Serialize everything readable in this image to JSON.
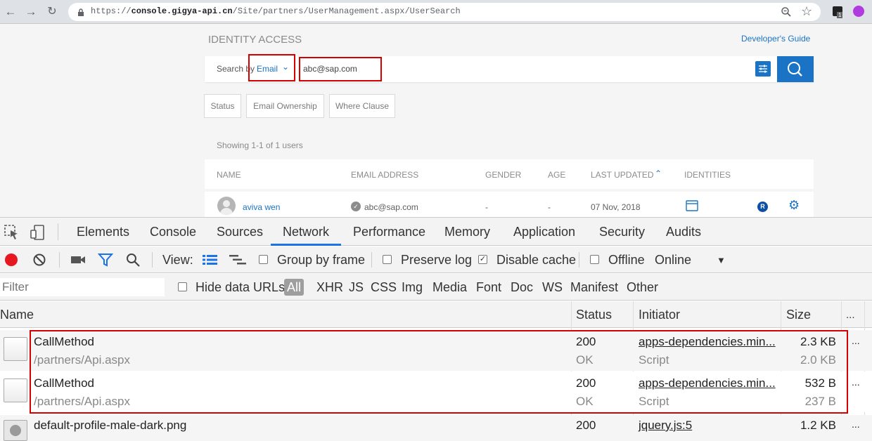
{
  "browser": {
    "url_scheme": "https://",
    "url_host": "console.gigya-api.cn",
    "url_path": "/Site/partners/UserManagement.aspx/UserSearch",
    "ext_badge": "1"
  },
  "page": {
    "section_title": "IDENTITY ACCESS",
    "developer_guide_link": "Developer's Guide",
    "search_by_label": "Search by",
    "search_field": "Email",
    "search_value": "abc@sap.com",
    "filter_chips": [
      "Status",
      "Email Ownership",
      "Where Clause"
    ],
    "showing_text": "Showing 1-1 of 1 users",
    "table": {
      "columns": [
        "NAME",
        "EMAIL ADDRESS",
        "GENDER",
        "AGE",
        "LAST UPDATED",
        "IDENTITIES"
      ],
      "row": {
        "name": "aviva wen",
        "email": "abc@sap.com",
        "gender": "-",
        "age": "-",
        "last_updated": "07 Nov, 2018"
      }
    }
  },
  "devtools": {
    "tabs": [
      "Elements",
      "Console",
      "Sources",
      "Network",
      "Performance",
      "Memory",
      "Application",
      "Security",
      "Audits"
    ],
    "active_tab": "Network",
    "toolbar": {
      "view_label": "View:",
      "group_by_frame": "Group by frame",
      "preserve_log": "Preserve log",
      "disable_cache": "Disable cache",
      "offline": "Offline",
      "throttle": "Online"
    },
    "filter": {
      "placeholder": "Filter",
      "hide_data_urls": "Hide data URLs",
      "types": [
        "All",
        "XHR",
        "JS",
        "CSS",
        "Img",
        "Media",
        "Font",
        "Doc",
        "WS",
        "Manifest",
        "Other"
      ]
    },
    "columns": [
      "Name",
      "Status",
      "Initiator",
      "Size",
      "..."
    ],
    "requests": [
      {
        "name": "CallMethod",
        "path": "/partners/Api.aspx",
        "status": "200",
        "status_text": "OK",
        "initiator": "apps-dependencies.min...",
        "initiator_type": "Script",
        "size": "2.3 KB",
        "size2": "2.0 KB",
        "more": "..."
      },
      {
        "name": "CallMethod",
        "path": "/partners/Api.aspx",
        "status": "200",
        "status_text": "OK",
        "initiator": "apps-dependencies.min...",
        "initiator_type": "Script",
        "size": "532 B",
        "size2": "237 B",
        "more": "..."
      },
      {
        "name": "default-profile-male-dark.png",
        "path": "",
        "status": "200",
        "status_text": "",
        "initiator": "jquery.js:5",
        "initiator_type": "",
        "size": "1.2 KB",
        "size2": "",
        "more": "..."
      }
    ]
  },
  "colors": {
    "accent": "#1a73c4",
    "highlight_red": "#d50000",
    "record_red": "#e8171f",
    "filter_blue": "#1a73e8"
  }
}
